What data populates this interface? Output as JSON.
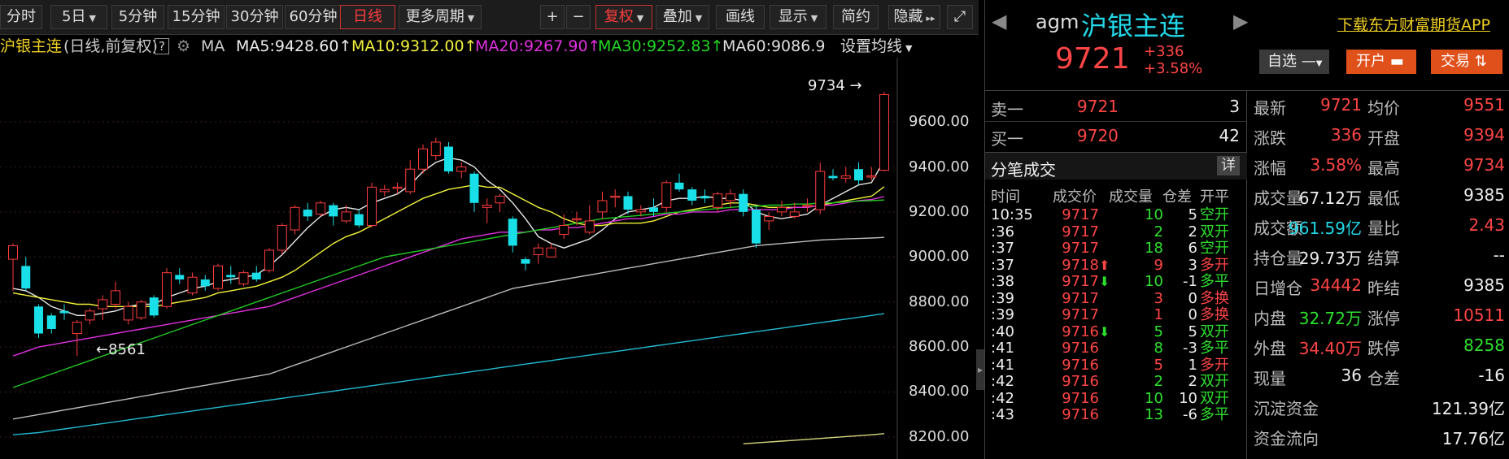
{
  "toolbar": {
    "tabs": [
      {
        "label": "分时"
      },
      {
        "label": "5日"
      },
      {
        "label": "5分钟"
      },
      {
        "label": "15分钟"
      },
      {
        "label": "30分钟"
      },
      {
        "label": "60分钟"
      },
      {
        "label": "日线"
      },
      {
        "label": "更多周期"
      }
    ],
    "plus": "+",
    "minus": "−",
    "fuquan": "复权",
    "diejia": "叠加",
    "huaxian": "画线",
    "xianshi": "显示",
    "jianyue": "简约",
    "yincang": "隐藏"
  },
  "ma_line": {
    "name": "沪银主连",
    "sub": "(日线,前复权)",
    "help": "?",
    "ma": "MA",
    "ma5": "MA5:9428.60",
    "ma10": "MA10:9312.00",
    "ma20": "MA20:9267.90",
    "ma30": "MA30:9252.83",
    "ma60": "MA60:9086.9",
    "setting": "设置均线"
  },
  "chart_data": {
    "type": "candlestick",
    "y_ticks": [
      "9600.00",
      "9400.00",
      "9200.00",
      "9000.00",
      "8800.00",
      "8600.00",
      "8400.00",
      "8200.00"
    ],
    "ylim": [
      8170,
      9760
    ],
    "annotations": [
      {
        "text": "9734",
        "value": 9734
      },
      {
        "text": "8561",
        "value": 8561
      }
    ],
    "candles": [
      [
        8990,
        9050,
        8850,
        9060
      ],
      [
        8960,
        8860,
        8850,
        9000
      ],
      [
        8780,
        8660,
        8640,
        8790
      ],
      [
        8740,
        8680,
        8660,
        8750
      ],
      [
        8760,
        8750,
        8720,
        8790
      ],
      [
        8660,
        8710,
        8560,
        8720
      ],
      [
        8720,
        8760,
        8700,
        8770
      ],
      [
        8770,
        8810,
        8720,
        8830
      ],
      [
        8790,
        8850,
        8770,
        8890
      ],
      [
        8720,
        8780,
        8700,
        8800
      ],
      [
        8730,
        8800,
        8720,
        8810
      ],
      [
        8820,
        8740,
        8730,
        8830
      ],
      [
        8780,
        8930,
        8770,
        8950
      ],
      [
        8920,
        8900,
        8880,
        8950
      ],
      [
        8840,
        8910,
        8830,
        8930
      ],
      [
        8900,
        8870,
        8850,
        8920
      ],
      [
        8860,
        8960,
        8850,
        8970
      ],
      [
        8920,
        8910,
        8880,
        8960
      ],
      [
        8880,
        8930,
        8870,
        8940
      ],
      [
        8930,
        8900,
        8890,
        8960
      ],
      [
        8940,
        9030,
        8930,
        9040
      ],
      [
        9030,
        9140,
        9010,
        9150
      ],
      [
        9120,
        9220,
        9100,
        9230
      ],
      [
        9210,
        9180,
        9160,
        9240
      ],
      [
        9190,
        9240,
        9180,
        9250
      ],
      [
        9230,
        9180,
        9140,
        9240
      ],
      [
        9160,
        9200,
        9150,
        9230
      ],
      [
        9190,
        9140,
        9130,
        9210
      ],
      [
        9140,
        9310,
        9130,
        9330
      ],
      [
        9290,
        9300,
        9270,
        9320
      ],
      [
        9310,
        9310,
        9280,
        9330
      ],
      [
        9290,
        9390,
        9280,
        9430
      ],
      [
        9390,
        9480,
        9370,
        9500
      ],
      [
        9450,
        9510,
        9430,
        9530
      ],
      [
        9490,
        9380,
        9370,
        9510
      ],
      [
        9380,
        9400,
        9350,
        9420
      ],
      [
        9370,
        9240,
        9200,
        9380
      ],
      [
        9220,
        9230,
        9150,
        9260
      ],
      [
        9240,
        9270,
        9200,
        9280
      ],
      [
        9170,
        9050,
        9020,
        9180
      ],
      [
        8990,
        8970,
        8940,
        9000
      ],
      [
        9010,
        9040,
        8970,
        9060
      ],
      [
        9000,
        9040,
        9000,
        9060
      ],
      [
        9100,
        9140,
        9080,
        9190
      ],
      [
        9170,
        9170,
        9140,
        9200
      ],
      [
        9110,
        9160,
        9100,
        9230
      ],
      [
        9200,
        9250,
        9170,
        9290
      ],
      [
        9270,
        9270,
        9220,
        9300
      ],
      [
        9270,
        9210,
        9190,
        9290
      ],
      [
        9200,
        9210,
        9180,
        9230
      ],
      [
        9220,
        9200,
        9180,
        9260
      ],
      [
        9220,
        9330,
        9200,
        9340
      ],
      [
        9330,
        9300,
        9290,
        9370
      ],
      [
        9300,
        9250,
        9230,
        9310
      ],
      [
        9270,
        9260,
        9240,
        9300
      ],
      [
        9220,
        9280,
        9200,
        9290
      ],
      [
        9250,
        9280,
        9220,
        9300
      ],
      [
        9280,
        9200,
        9180,
        9300
      ],
      [
        9210,
        9060,
        9040,
        9230
      ],
      [
        9160,
        9180,
        9120,
        9200
      ],
      [
        9200,
        9220,
        9180,
        9250
      ],
      [
        9180,
        9200,
        9170,
        9240
      ],
      [
        9230,
        9230,
        9200,
        9260
      ],
      [
        9210,
        9380,
        9190,
        9420
      ],
      [
        9360,
        9350,
        9340,
        9390
      ],
      [
        9350,
        9360,
        9330,
        9400
      ],
      [
        9390,
        9340,
        9320,
        9420
      ],
      [
        9360,
        9360,
        9340,
        9400
      ],
      [
        9385,
        9721,
        9380,
        9734
      ]
    ],
    "ma_series": [
      {
        "name": "MA5",
        "color": "#e8e8e8",
        "values": [
          8860,
          8850,
          8820,
          8780,
          8760,
          8740,
          8740,
          8750,
          8760,
          8780,
          8790,
          8790,
          8820,
          8840,
          8860,
          8870,
          8890,
          8900,
          8910,
          8920,
          8960,
          9010,
          9070,
          9130,
          9180,
          9210,
          9220,
          9210,
          9240,
          9260,
          9280,
          9320,
          9380,
          9420,
          9440,
          9430,
          9400,
          9340,
          9300,
          9240,
          9170,
          9090,
          9060,
          9040,
          9060,
          9080,
          9120,
          9170,
          9200,
          9210,
          9220,
          9250,
          9260,
          9260,
          9270,
          9260,
          9260,
          9250,
          9200,
          9180,
          9170,
          9180,
          9190,
          9230,
          9260,
          9290,
          9320,
          9330,
          9430
        ]
      },
      {
        "name": "MA10",
        "color": "#f2f23a",
        "values": [
          8840,
          8830,
          8820,
          8810,
          8800,
          8790,
          8790,
          8780,
          8780,
          8780,
          8780,
          8780,
          8790,
          8800,
          8810,
          8820,
          8840,
          8850,
          8860,
          8870,
          8890,
          8910,
          8940,
          8980,
          9020,
          9060,
          9090,
          9110,
          9140,
          9170,
          9200,
          9230,
          9260,
          9280,
          9300,
          9310,
          9320,
          9310,
          9310,
          9280,
          9250,
          9220,
          9200,
          9170,
          9150,
          9140,
          9140,
          9150,
          9150,
          9150,
          9160,
          9180,
          9200,
          9210,
          9220,
          9230,
          9240,
          9240,
          9230,
          9220,
          9220,
          9220,
          9220,
          9230,
          9240,
          9250,
          9260,
          9270,
          9312
        ]
      },
      {
        "name": "MA20",
        "color": "#e030e0",
        "values": [
          8560,
          8580,
          8600,
          8610,
          8620,
          8630,
          8640,
          8650,
          8660,
          8670,
          8680,
          8690,
          8700,
          8710,
          8720,
          8730,
          8740,
          8750,
          8760,
          8770,
          8780,
          8800,
          8820,
          8840,
          8860,
          8880,
          8900,
          8920,
          8940,
          8960,
          8980,
          9000,
          9020,
          9040,
          9060,
          9080,
          9090,
          9100,
          9110,
          9110,
          9110,
          9120,
          9120,
          9130,
          9130,
          9140,
          9150,
          9160,
          9170,
          9170,
          9180,
          9190,
          9190,
          9200,
          9200,
          9200,
          9210,
          9210,
          9210,
          9210,
          9210,
          9220,
          9220,
          9230,
          9230,
          9240,
          9250,
          9255,
          9268
        ]
      },
      {
        "name": "MA30",
        "color": "#22c822",
        "values": [
          8420,
          8440,
          8460,
          8480,
          8500,
          8520,
          8540,
          8560,
          8580,
          8600,
          8620,
          8640,
          8660,
          8680,
          8700,
          8720,
          8740,
          8760,
          8780,
          8800,
          8820,
          8840,
          8860,
          8880,
          8900,
          8920,
          8940,
          8960,
          8980,
          9000,
          9010,
          9020,
          9030,
          9040,
          9050,
          9060,
          9070,
          9080,
          9090,
          9100,
          9110,
          9120,
          9130,
          9140,
          9150,
          9160,
          9170,
          9175,
          9180,
          9185,
          9190,
          9195,
          9200,
          9205,
          9210,
          9215,
          9220,
          9225,
          9225,
          9230,
          9230,
          9235,
          9235,
          9240,
          9240,
          9245,
          9248,
          9250,
          9253
        ]
      },
      {
        "name": "MA60",
        "color": "#bbbbbb",
        "values": [
          8280,
          8290,
          8300,
          8310,
          8320,
          8330,
          8340,
          8350,
          8360,
          8370,
          8380,
          8390,
          8400,
          8410,
          8420,
          8430,
          8440,
          8450,
          8460,
          8470,
          8480,
          8500,
          8520,
          8540,
          8560,
          8580,
          8600,
          8620,
          8640,
          8660,
          8680,
          8700,
          8720,
          8740,
          8760,
          8780,
          8800,
          8820,
          8840,
          8860,
          8870,
          8880,
          8890,
          8900,
          8910,
          8920,
          8930,
          8940,
          8950,
          8960,
          8970,
          8980,
          8990,
          9000,
          9010,
          9020,
          9030,
          9040,
          9050,
          9055,
          9060,
          9065,
          9070,
          9075,
          9078,
          9080,
          9082,
          9084,
          9087
        ]
      },
      {
        "name": "MA120",
        "color": "#22b8d0",
        "values": [
          8210,
          8215,
          8220,
          8228,
          8236,
          8244,
          8252,
          8260,
          8268,
          8276,
          8284,
          8292,
          8300,
          8308,
          8316,
          8324,
          8332,
          8340,
          8348,
          8356,
          8364,
          8372,
          8380,
          8388,
          8396,
          8404,
          8412,
          8420,
          8428,
          8436,
          8444,
          8452,
          8460,
          8468,
          8476,
          8484,
          8492,
          8500,
          8508,
          8516,
          8524,
          8532,
          8540,
          8548,
          8556,
          8564,
          8572,
          8580,
          8588,
          8596,
          8604,
          8612,
          8620,
          8628,
          8636,
          8644,
          8652,
          8660,
          8668,
          8676,
          8684,
          8692,
          8700,
          8708,
          8716,
          8724,
          8732,
          8740,
          8748
        ]
      },
      {
        "name": "MA250",
        "color": "#d8d880",
        "values": [
          null,
          null,
          null,
          null,
          null,
          null,
          null,
          null,
          null,
          null,
          null,
          null,
          null,
          null,
          null,
          null,
          null,
          null,
          null,
          null,
          null,
          null,
          null,
          null,
          null,
          null,
          null,
          null,
          null,
          null,
          null,
          null,
          null,
          null,
          null,
          null,
          null,
          null,
          null,
          null,
          null,
          null,
          null,
          null,
          null,
          null,
          null,
          null,
          null,
          null,
          null,
          null,
          null,
          null,
          null,
          null,
          null,
          8170,
          8174,
          8178,
          8182,
          8186,
          8190,
          8194,
          8198,
          8202,
          8206,
          8210,
          8215
        ]
      }
    ]
  },
  "header": {
    "code": "agm",
    "name": "沪银主连",
    "price": "9721",
    "change": "+336",
    "pct": "+3.58%",
    "zixuan": "自选",
    "kaihu": "开户",
    "jiaoyi": "交易",
    "download": "下载东方财富期货APP"
  },
  "book": {
    "sell_label": "卖一",
    "sell_price": "9721",
    "sell_vol": "3",
    "buy_label": "买一",
    "buy_price": "9720",
    "buy_vol": "42"
  },
  "ticks": {
    "title": "分笔成交",
    "detail": "详",
    "headers": [
      "时间",
      "成交价",
      "成交量",
      "仓差",
      "开平"
    ],
    "rows": [
      {
        "t": "10:35",
        "p": "9717",
        "v": "10",
        "d": "5",
        "k": "空开",
        "pc": "red",
        "kc": "green",
        "dir": ""
      },
      {
        "t": ":36",
        "p": "9717",
        "v": "2",
        "d": "2",
        "k": "双开",
        "pc": "red",
        "kc": "green",
        "dir": ""
      },
      {
        "t": ":37",
        "p": "9717",
        "v": "18",
        "d": "6",
        "k": "空开",
        "pc": "red",
        "kc": "green",
        "dir": ""
      },
      {
        "t": ":37",
        "p": "9718",
        "v": "9",
        "d": "3",
        "k": "多开",
        "pc": "red",
        "kc": "red",
        "dir": "up"
      },
      {
        "t": ":38",
        "p": "9717",
        "v": "10",
        "d": "-1",
        "k": "多平",
        "pc": "red",
        "kc": "green",
        "dir": "down"
      },
      {
        "t": ":39",
        "p": "9717",
        "v": "3",
        "d": "0",
        "k": "多换",
        "pc": "red",
        "kc": "red",
        "dir": ""
      },
      {
        "t": ":39",
        "p": "9717",
        "v": "1",
        "d": "0",
        "k": "多换",
        "pc": "red",
        "kc": "red",
        "dir": ""
      },
      {
        "t": ":40",
        "p": "9716",
        "v": "5",
        "d": "5",
        "k": "双开",
        "pc": "red",
        "kc": "green",
        "dir": "down"
      },
      {
        "t": ":41",
        "p": "9716",
        "v": "8",
        "d": "-3",
        "k": "多平",
        "pc": "red",
        "kc": "green",
        "dir": ""
      },
      {
        "t": ":41",
        "p": "9716",
        "v": "5",
        "d": "1",
        "k": "多开",
        "pc": "red",
        "kc": "red",
        "dir": ""
      },
      {
        "t": ":42",
        "p": "9716",
        "v": "2",
        "d": "2",
        "k": "双开",
        "pc": "red",
        "kc": "green",
        "dir": ""
      },
      {
        "t": ":42",
        "p": "9716",
        "v": "10",
        "d": "10",
        "k": "双开",
        "pc": "red",
        "kc": "green",
        "dir": ""
      },
      {
        "t": ":43",
        "p": "9716",
        "v": "13",
        "d": "-6",
        "k": "多平",
        "pc": "red",
        "kc": "green",
        "dir": ""
      }
    ]
  },
  "stats": [
    {
      "l1": "最新",
      "v1": "9721",
      "c1": "red",
      "l2": "均价",
      "v2": "9551",
      "c2": "red"
    },
    {
      "l1": "涨跌",
      "v1": "336",
      "c1": "red",
      "l2": "开盘",
      "v2": "9394",
      "c2": "red"
    },
    {
      "l1": "涨幅",
      "v1": "3.58%",
      "c1": "red",
      "l2": "最高",
      "v2": "9734",
      "c2": "red"
    },
    {
      "l1": "成交量",
      "v1": "67.12万",
      "c1": "white",
      "l2": "最低",
      "v2": "9385",
      "c2": "white"
    },
    {
      "l1": "成交额",
      "v1": "961.59亿",
      "c1": "cyan",
      "l2": "量比",
      "v2": "2.43",
      "c2": "red"
    },
    {
      "l1": "持仓量",
      "v1": "29.73万",
      "c1": "white",
      "l2": "结算",
      "v2": "--",
      "c2": "white"
    },
    {
      "l1": "日增仓",
      "v1": "34442",
      "c1": "red",
      "l2": "昨结",
      "v2": "9385",
      "c2": "white"
    },
    {
      "l1": "内盘",
      "v1": "32.72万",
      "c1": "green",
      "l2": "涨停",
      "v2": "10511",
      "c2": "red"
    },
    {
      "l1": "外盘",
      "v1": "34.40万",
      "c1": "red",
      "l2": "跌停",
      "v2": "8258",
      "c2": "green"
    },
    {
      "l1": "现量",
      "v1": "36",
      "c1": "white",
      "l2": "仓差",
      "v2": "-16",
      "c2": "white"
    }
  ],
  "fund": [
    {
      "l": "沉淀资金",
      "v": "121.39亿"
    },
    {
      "l": "资金流向",
      "v": "17.76亿"
    }
  ]
}
